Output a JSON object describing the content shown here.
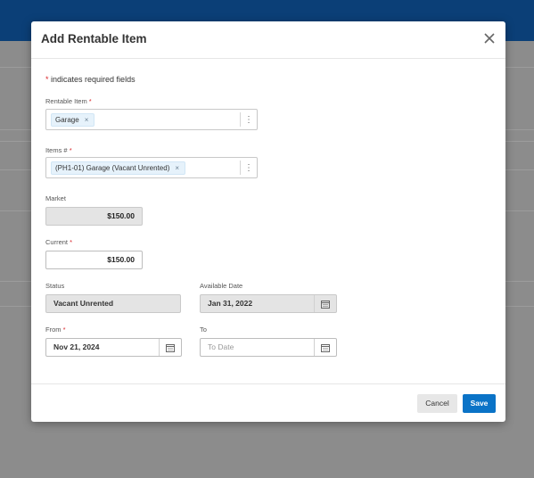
{
  "modal": {
    "title": "Add Rentable Item",
    "required_note_star": "*",
    "required_note": " indicates required fields"
  },
  "fields": {
    "rentable_item": {
      "label": "Rentable Item",
      "required": "*",
      "chip": "Garage"
    },
    "items_num": {
      "label": "Items #",
      "required": "*",
      "chip": "(PH1-01) Garage (Vacant Unrented)"
    },
    "market": {
      "label": "Market",
      "value": "$150.00"
    },
    "current": {
      "label": "Current",
      "required": "*",
      "value": "$150.00"
    },
    "status": {
      "label": "Status",
      "value": "Vacant Unrented"
    },
    "available_date": {
      "label": "Available Date",
      "value": "Jan 31, 2022"
    },
    "from": {
      "label": "From",
      "required": "*",
      "value": "Nov 21, 2024"
    },
    "to": {
      "label": "To",
      "placeholder": "To Date"
    }
  },
  "buttons": {
    "cancel": "Cancel",
    "save": "Save"
  },
  "colors": {
    "accent": "#0a73c7",
    "required": "#d9262b",
    "header": "#0b3f77"
  }
}
